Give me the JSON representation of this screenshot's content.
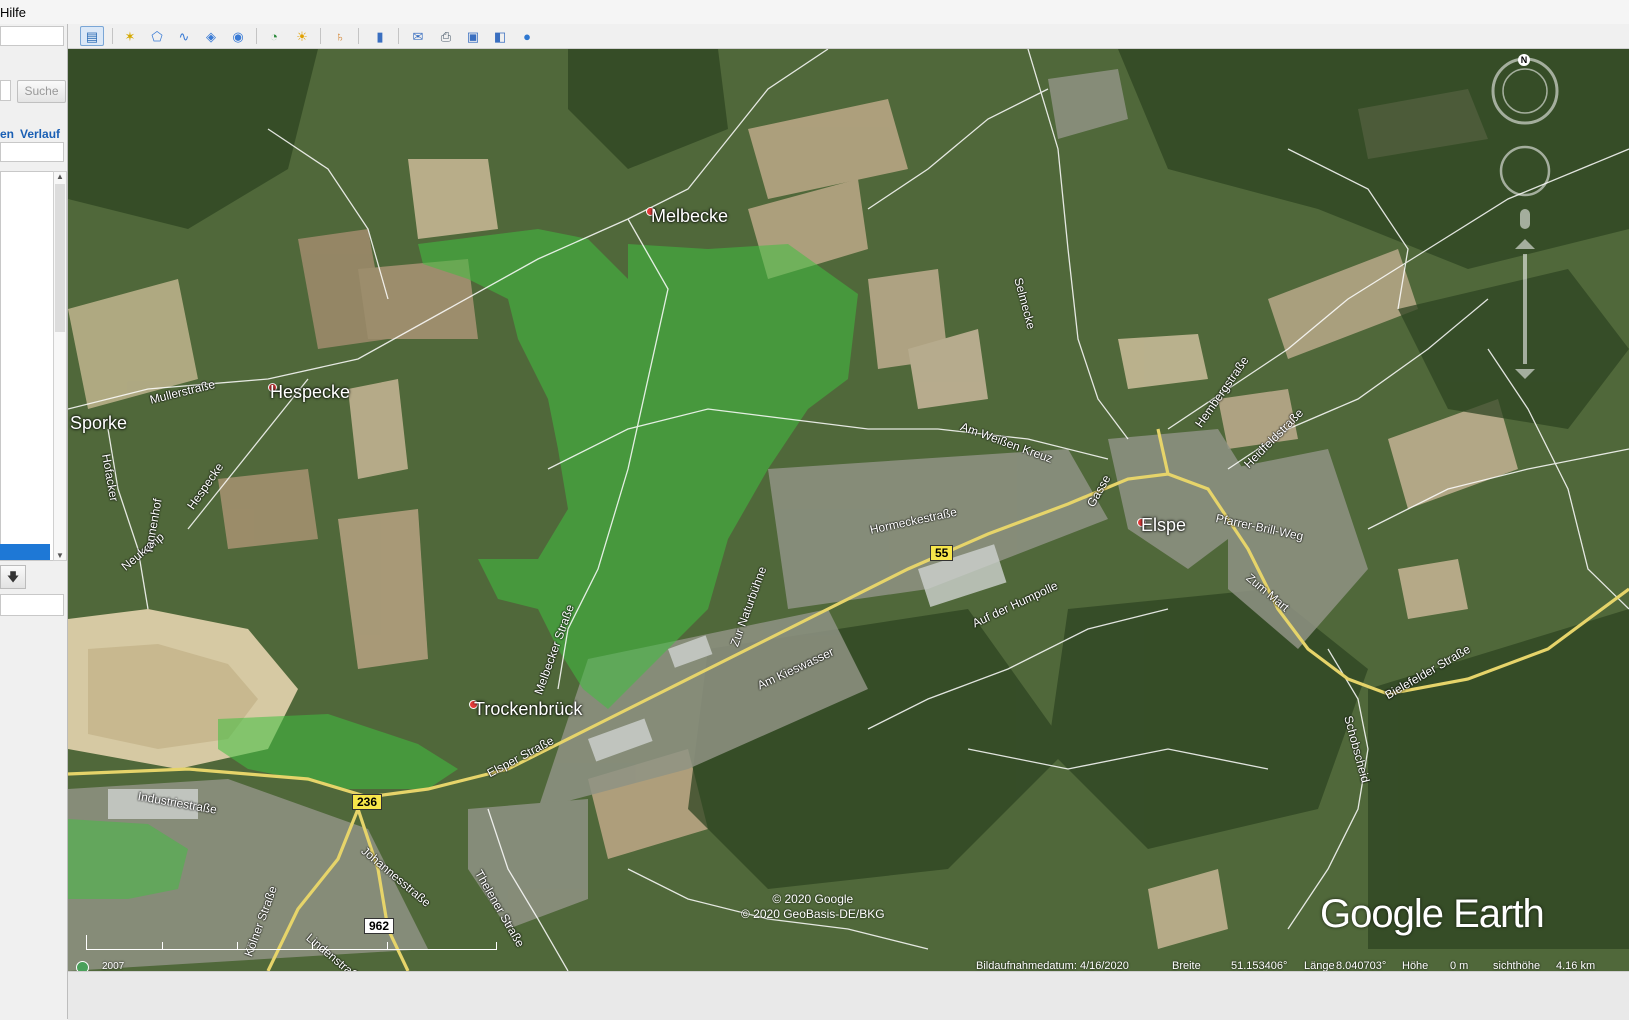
{
  "menubar": {
    "item": "Hilfe"
  },
  "sidebar": {
    "search_button": "Suche",
    "tab_places": "en",
    "tab_history": "Verlauf"
  },
  "toolbar": {
    "buttons": [
      {
        "name": "sidebar-toggle-icon",
        "glyph": "▤"
      },
      {
        "name": "add-placemark-icon",
        "glyph": "✶"
      },
      {
        "name": "add-polygon-icon",
        "glyph": "⬠"
      },
      {
        "name": "add-path-icon",
        "glyph": "∿"
      },
      {
        "name": "add-image-overlay-icon",
        "glyph": "◈"
      },
      {
        "name": "record-tour-icon",
        "glyph": "◉"
      },
      {
        "name": "historical-imagery-icon",
        "glyph": "◔"
      },
      {
        "name": "sunlight-icon",
        "glyph": "☀"
      },
      {
        "name": "planets-icon",
        "glyph": "♄"
      },
      {
        "name": "ruler-icon",
        "glyph": "▮"
      },
      {
        "name": "email-icon",
        "glyph": "✉"
      },
      {
        "name": "print-icon",
        "glyph": "⎙"
      },
      {
        "name": "save-image-icon",
        "glyph": "▣"
      },
      {
        "name": "view-in-maps-icon",
        "glyph": "◧"
      },
      {
        "name": "earth-icon",
        "glyph": "●"
      }
    ]
  },
  "map": {
    "places": {
      "melbecke": "Melbecke",
      "hespecke": "Hespecke",
      "sporke": "Sporke",
      "trockenbruck": "Trockenbrück",
      "elspe": "Elspe"
    },
    "roads": {
      "mullerstrasse": "Mullerstraße",
      "hespecke": "Hespecke",
      "hofacker": "Hofacker",
      "neukamp": "Neukamp",
      "tannenhof": "Tannenhof",
      "melbecker_strasse": "Melbecker Straße",
      "selmecke": "Selmecke",
      "am_weissen_kreuz": "Am Weißen Kreuz",
      "hormeckestrasse": "Hormeckestraße",
      "gasse": "Gasse",
      "hembergstrasse": "Hembergstraße",
      "heidfeldstrasse": "Heidfeldstraße",
      "pfarrer_brill_weg": "Pfarrer-Brill-Weg",
      "zum_mart": "Zum Mart",
      "zur_naturbuhne": "Zur Naturbühne",
      "auf_der_humpolle": "Auf der Humpolle",
      "am_kieswasser": "Am Kieswasser",
      "elsper_strasse": "Elsper Straße",
      "industriestrasse": "Industriestraße",
      "johannesstrasse": "Johannesstraße",
      "kolner_strasse": "Kölner Straße",
      "lindenstrasse": "Lindenstraße",
      "thelener_strasse": "Thelener Straße",
      "schobscheid": "Schobscheid",
      "bielefelder_strasse": "Bielefelder Straße"
    },
    "shields": {
      "b55": "55",
      "b236": "236",
      "l962": "962"
    },
    "copyright_line1": "© 2020 Google",
    "copyright_line2": "© 2020 GeoBasis-DE/BKG",
    "logo": "Google Earth",
    "compass_north": "N"
  },
  "statusbar": {
    "year": "2007",
    "capture_date": "Bildaufnahmedatum: 4/16/2020",
    "lat_label": "Breite",
    "lat_value": "51.153406°",
    "lon_label": "Länge",
    "lon_value": "8.040703°",
    "elev_label": "Höhe",
    "elev_value": "0 m",
    "eye_label": "sichthöhe",
    "eye_value": "4.16 km"
  },
  "colors": {
    "highlight_polygon": "#3fbf3f",
    "road_main": "#e6d46a",
    "shield_bg": "#f7e64a",
    "selection": "#1e78d6"
  }
}
